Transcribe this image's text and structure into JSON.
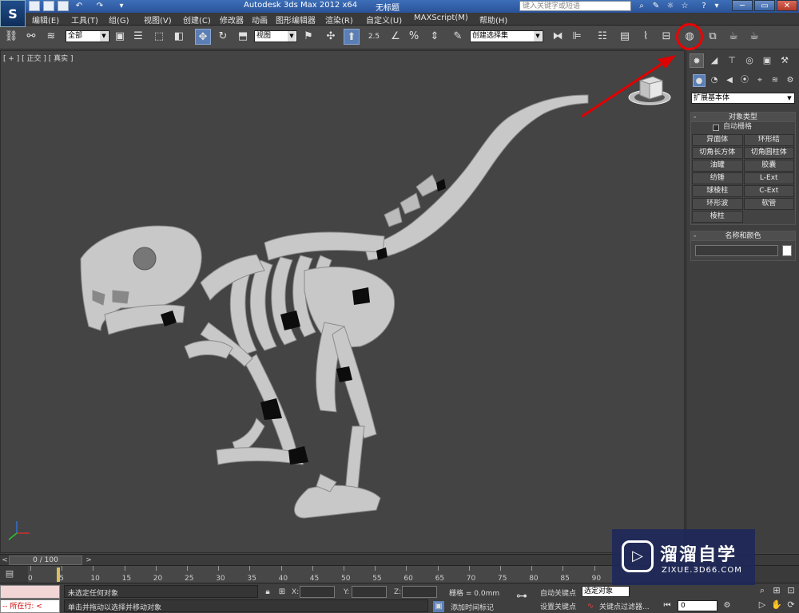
{
  "titlebar": {
    "app_title": "Autodesk 3ds Max  2012 x64",
    "doc_title": "无标题",
    "search_placeholder": "键入关键字或短语",
    "minimize": "─",
    "restore": "▭",
    "close": "✕"
  },
  "menu": {
    "items": [
      "编辑(E)",
      "工具(T)",
      "组(G)",
      "视图(V)",
      "创建(C)",
      "修改器",
      "动画",
      "图形编辑器",
      "渲染(R)",
      "自定义(U)",
      "MAXScript(M)",
      "帮助(H)"
    ]
  },
  "toolbar": {
    "selection_filter": "全部",
    "reference_coord": "视图",
    "snap_angle": "2.5",
    "named_selection": "创建选择集"
  },
  "viewport": {
    "label": "[ + ] [ 正交 ] [ 真实 ]"
  },
  "command_panel": {
    "category": "扩展基本体",
    "object_type_title": "对象类型",
    "autogrid_label": "自动栅格",
    "object_buttons": [
      "异面体",
      "环形结",
      "切角长方体",
      "切角圆柱体",
      "油罐",
      "胶囊",
      "纺锤",
      "L-Ext",
      "球棱柱",
      "C-Ext",
      "环形波",
      "软管",
      "棱柱"
    ],
    "name_color_title": "名称和颜色",
    "collapse_symbol": "-"
  },
  "timeline": {
    "frame_counter": "0 / 100",
    "ticks": [
      "0",
      "5",
      "10",
      "15",
      "20",
      "25",
      "30",
      "35",
      "40",
      "45",
      "50",
      "55",
      "60",
      "65",
      "70",
      "75",
      "80",
      "85",
      "90"
    ]
  },
  "status": {
    "maxscript_prompt": "-- 所在行: <",
    "selection_status": "未选定任何对象",
    "prompt": "单击并拖动以选择并移动对象",
    "x_label": "X:",
    "y_label": "Y:",
    "z_label": "Z:",
    "grid": "栅格 = 0.0mm",
    "add_time_tag": "添加时间标记",
    "auto_key": "自动关键点",
    "set_key": "设置关键点",
    "selection_filter": "选定对象",
    "key_filters": "关键点过滤器...",
    "frame": "0"
  },
  "watermark": {
    "title": "溜溜自学",
    "url": "ZIXUE.3D66.COM"
  },
  "colors": {
    "highlight": "#e00000",
    "active_tool": "#5b7fb5"
  }
}
